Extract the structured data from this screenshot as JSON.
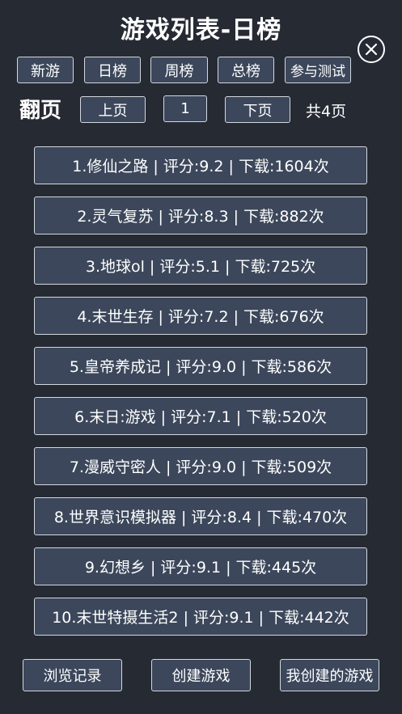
{
  "header": {
    "title": "游戏列表-日榜"
  },
  "tabs": [
    {
      "label": "新游"
    },
    {
      "label": "日榜"
    },
    {
      "label": "周榜"
    },
    {
      "label": "总榜"
    },
    {
      "label": "参与测试"
    }
  ],
  "pager": {
    "label": "翻页",
    "prev_label": "上页",
    "current_page": "1",
    "next_label": "下页",
    "total_text": "共4页"
  },
  "games": [
    {
      "text": "1.修仙之路 | 评分:9.2 | 下载:1604次"
    },
    {
      "text": "2.灵气复苏 | 评分:8.3 | 下载:882次"
    },
    {
      "text": "3.地球ol | 评分:5.1 | 下载:725次"
    },
    {
      "text": "4.末世生存 | 评分:7.2 | 下载:676次"
    },
    {
      "text": "5.皇帝养成记 | 评分:9.0 | 下载:586次"
    },
    {
      "text": "6.末日:游戏 | 评分:7.1 | 下载:520次"
    },
    {
      "text": "7.漫威守密人 | 评分:9.0 | 下载:509次"
    },
    {
      "text": "8.世界意识模拟器 | 评分:8.4 | 下载:470次"
    },
    {
      "text": "9.幻想乡 | 评分:9.1 | 下载:445次"
    },
    {
      "text": "10.末世特摄生活2 | 评分:9.1 | 下载:442次"
    }
  ],
  "footer": {
    "history_label": "浏览记录",
    "create_label": "创建游戏",
    "my_games_label": "我创建的游戏"
  },
  "icons": {
    "close": "close-icon"
  },
  "colors": {
    "background": "#252a33",
    "button_fill": "#3c475b",
    "button_border": "#d4d8de",
    "text": "#ffffff"
  }
}
